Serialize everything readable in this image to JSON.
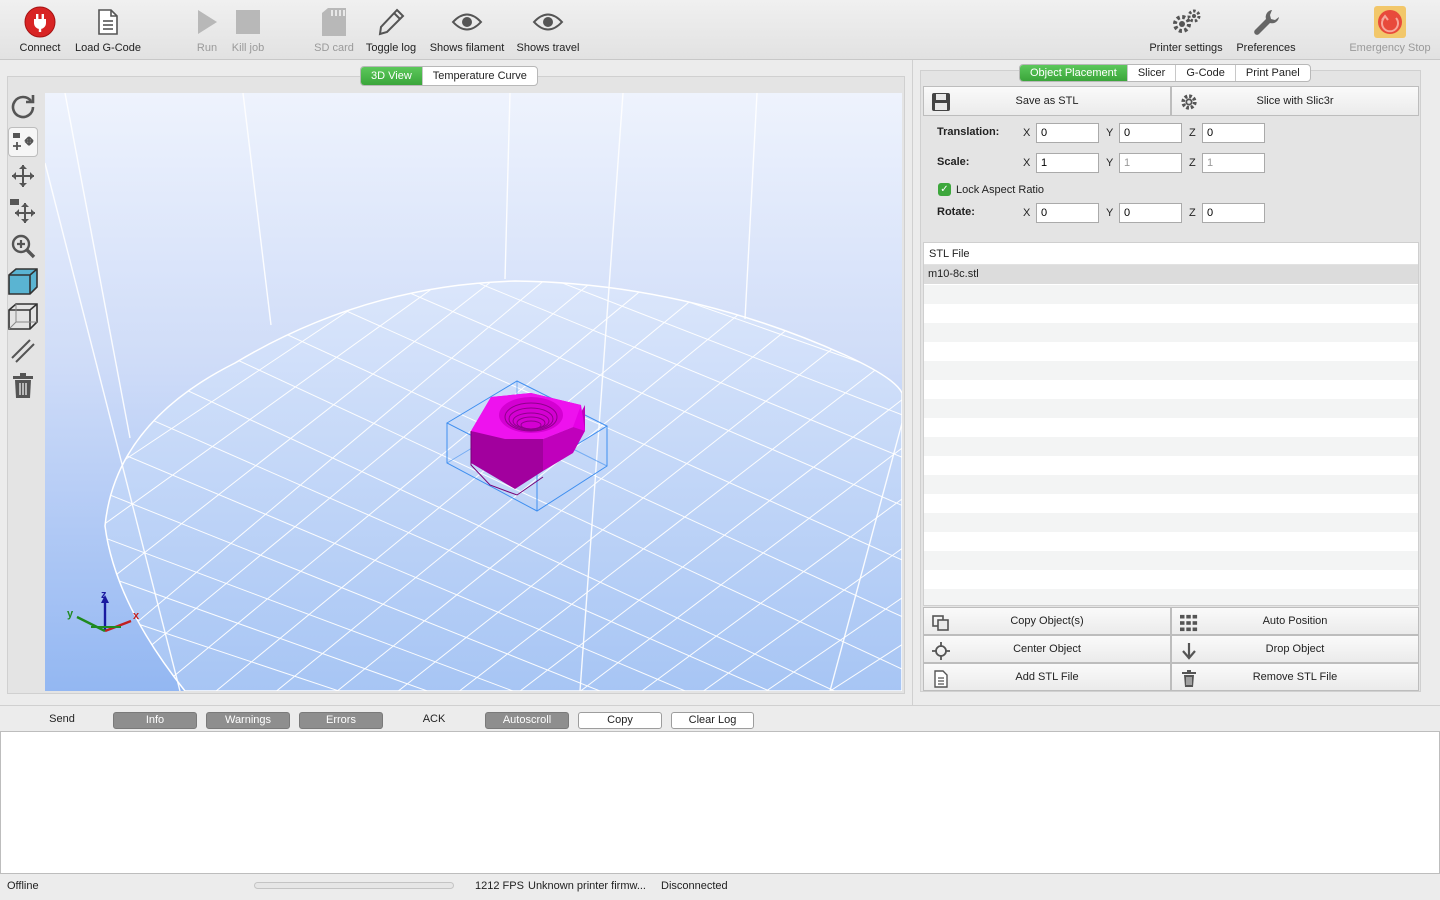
{
  "toolbar": {
    "connect": "Connect",
    "load_gcode": "Load G-Code",
    "run": "Run",
    "kill_job": "Kill job",
    "sd_card": "SD card",
    "toggle_log": "Toggle log",
    "shows_filament": "Shows filament",
    "shows_travel": "Shows travel",
    "printer_settings": "Printer settings",
    "preferences": "Preferences",
    "emergency_stop": "Emergency Stop"
  },
  "left_tabs": {
    "view3d": "3D View",
    "temperature": "Temperature Curve"
  },
  "right_tabs": {
    "placement": "Object Placement",
    "slicer": "Slicer",
    "gcode": "G-Code",
    "print_panel": "Print Panel"
  },
  "actions": {
    "save_stl": "Save as STL",
    "slice": "Slice with Slic3r",
    "copy_objects": "Copy Object(s)",
    "auto_position": "Auto Position",
    "center_object": "Center Object",
    "drop_object": "Drop Object",
    "add_stl": "Add STL File",
    "remove_stl": "Remove STL File"
  },
  "form": {
    "translation_label": "Translation:",
    "scale_label": "Scale:",
    "rotate_label": "Rotate:",
    "lock_aspect": "Lock Aspect Ratio",
    "axis_x": "X",
    "axis_y": "Y",
    "axis_z": "Z",
    "translation": {
      "x": "0",
      "y": "0",
      "z": "0"
    },
    "scale": {
      "x": "1",
      "y": "1",
      "z": "1"
    },
    "rotate": {
      "x": "0",
      "y": "0",
      "z": "0"
    }
  },
  "file_list": {
    "header": "STL File",
    "files": [
      "m10-8c.stl"
    ]
  },
  "axes_gizmo": {
    "x": "x",
    "y": "y",
    "z": "z"
  },
  "log": {
    "send": "Send",
    "info": "Info",
    "warnings": "Warnings",
    "errors": "Errors",
    "ack": "ACK",
    "autoscroll": "Autoscroll",
    "copy": "Copy",
    "clear": "Clear Log"
  },
  "status": {
    "state": "Offline",
    "fps": "1212 FPS",
    "firmware": "Unknown printer firmw...",
    "connection": "Disconnected",
    "progress": 0
  },
  "colors": {
    "accent_green": "#3aa53a",
    "object_magenta": "#e600e6",
    "bed_blue": "#9fc0f5",
    "stop_red": "#e84a3b"
  }
}
